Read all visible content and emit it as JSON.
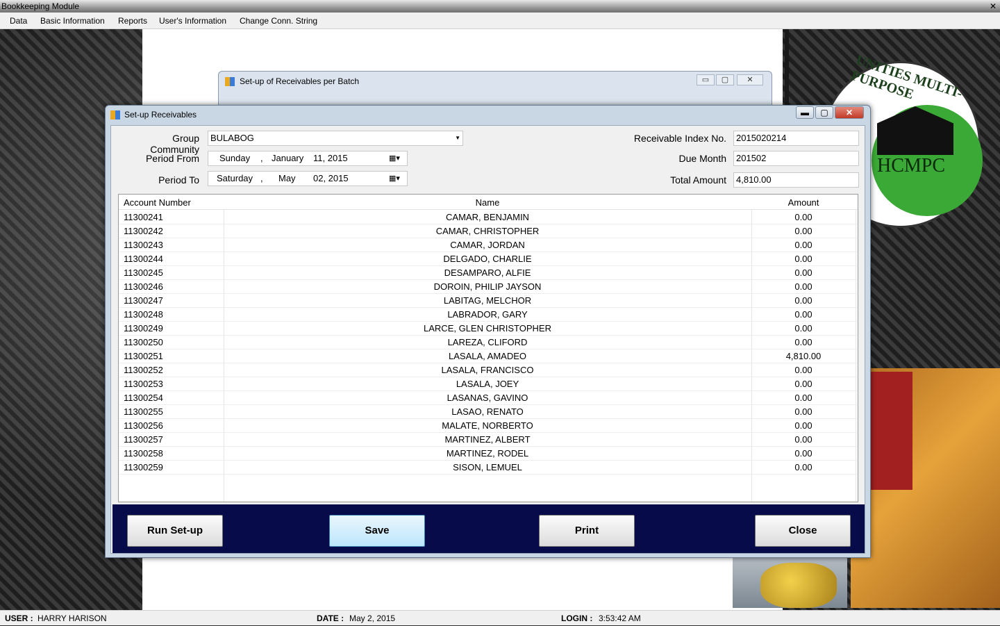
{
  "app": {
    "title": "Bookkeeping Module",
    "close_glyph": "✕"
  },
  "menu": [
    "Data",
    "Basic Information",
    "Reports",
    "User's Information",
    "Change Conn. String"
  ],
  "logo": {
    "arc_text": "UNITIES MULTI-PURPOSE",
    "abbrev": "HCMPC"
  },
  "batch_window": {
    "title": "Set-up of Receivables per Batch",
    "min_glyph": "▭",
    "max_glyph": "▢",
    "close_glyph": "✕"
  },
  "dialog": {
    "title": "Set-up Receivables",
    "min_glyph": "▬",
    "max_glyph": "▢",
    "close_glyph": "✕",
    "group_community_label": "Group Community",
    "group_community_value": "BULABOG",
    "period_from_label": "Period From",
    "period_from": {
      "day": "Sunday",
      "sep": ",",
      "month": "January",
      "date": "11, 2015"
    },
    "period_to_label": "Period To",
    "period_to": {
      "day": "Saturday",
      "sep": ",",
      "month": "May",
      "date": "02, 2015"
    },
    "receivable_index_label": "Receivable Index No.",
    "receivable_index_value": "2015020214",
    "due_month_label": "Due Month",
    "due_month_value": "201502",
    "total_amount_label": "Total Amount",
    "total_amount_value": "4,810.00",
    "calendar_glyph": "▦▾",
    "combo_glyph": "▼"
  },
  "grid": {
    "headers": [
      "Account Number",
      "Name",
      "Amount"
    ],
    "rows": [
      [
        "11300241",
        "CAMAR, BENJAMIN",
        "0.00"
      ],
      [
        "11300242",
        "CAMAR, CHRISTOPHER",
        "0.00"
      ],
      [
        "11300243",
        "CAMAR, JORDAN",
        "0.00"
      ],
      [
        "11300244",
        "DELGADO, CHARLIE",
        "0.00"
      ],
      [
        "11300245",
        "DESAMPARO, ALFIE",
        "0.00"
      ],
      [
        "11300246",
        "DOROIN, PHILIP JAYSON",
        "0.00"
      ],
      [
        "11300247",
        "LABITAG, MELCHOR",
        "0.00"
      ],
      [
        "11300248",
        "LABRADOR, GARY",
        "0.00"
      ],
      [
        "11300249",
        "LARCE, GLEN CHRISTOPHER",
        "0.00"
      ],
      [
        "11300250",
        "LAREZA, CLIFORD",
        "0.00"
      ],
      [
        "11300251",
        "LASALA, AMADEO",
        "4,810.00"
      ],
      [
        "11300252",
        "LASALA, FRANCISCO",
        "0.00"
      ],
      [
        "11300253",
        "LASALA, JOEY",
        "0.00"
      ],
      [
        "11300254",
        "LASANAS, GAVINO",
        "0.00"
      ],
      [
        "11300255",
        "LASAO, RENATO",
        "0.00"
      ],
      [
        "11300256",
        "MALATE, NORBERTO",
        "0.00"
      ],
      [
        "11300257",
        "MARTINEZ, ALBERT",
        "0.00"
      ],
      [
        "11300258",
        "MARTINEZ, RODEL",
        "0.00"
      ],
      [
        "11300259",
        "SISON, LEMUEL",
        "0.00"
      ]
    ]
  },
  "buttons": {
    "run_setup": "Run Set-up",
    "save": "Save",
    "print": "Print",
    "close": "Close"
  },
  "status": {
    "user_label": "USER :",
    "user_value": "HARRY HARISON",
    "date_label": "DATE :",
    "date_value": "May 2, 2015",
    "login_label": "LOGIN :",
    "login_value": "3:53:42 AM"
  },
  "colors": {
    "button_bar": "#070b4a",
    "logo_green": "#3aa935"
  }
}
